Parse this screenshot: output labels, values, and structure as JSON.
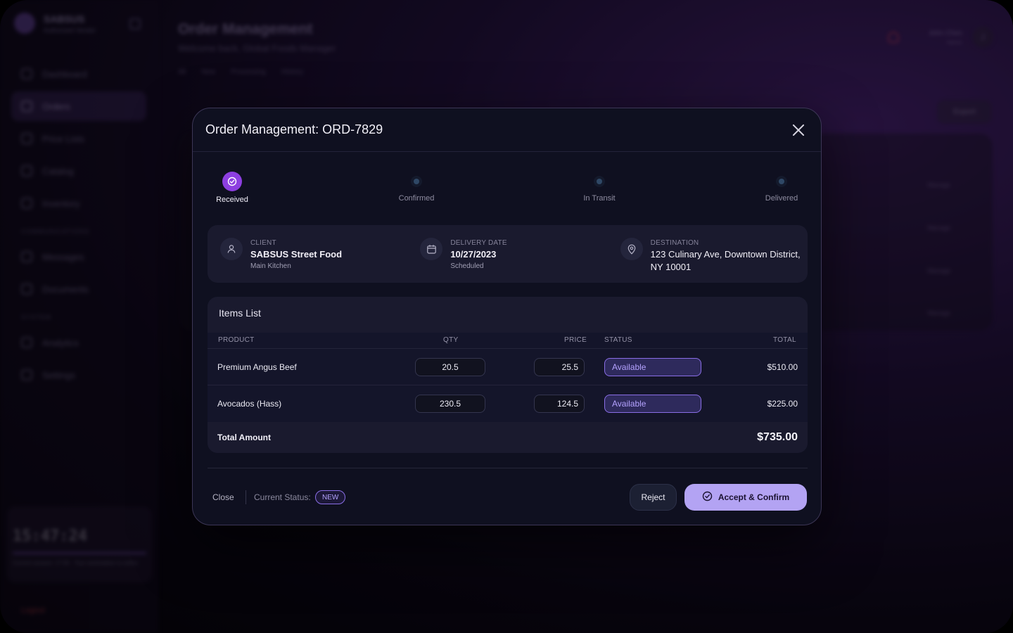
{
  "app": {
    "brand_name": "SABSUS",
    "brand_sub": "Authorized Vendor",
    "page_title": "Order Management",
    "page_subtitle": "Welcome back, Global Foods Manager",
    "filters": [
      "All",
      "New",
      "Processing",
      "History"
    ],
    "nav": [
      {
        "label": "Dashboard",
        "active": false
      },
      {
        "label": "Orders",
        "active": true
      },
      {
        "label": "Price Lists",
        "active": false
      },
      {
        "label": "Catalog",
        "active": false
      },
      {
        "label": "Inventory",
        "active": false
      }
    ],
    "nav_section_1": "Communications",
    "nav_comm": [
      {
        "label": "Messages"
      },
      {
        "label": "Documents"
      }
    ],
    "nav_section_2": "System",
    "nav_sys": [
      {
        "label": "Analytics"
      },
      {
        "label": "Settings"
      }
    ],
    "clock": {
      "time": "15:47:24",
      "note": "Current session: 17:56 · Your workstation is online"
    },
    "logout": "Logout",
    "user": {
      "name": "John Chen",
      "role": "Admin",
      "initial": "J"
    },
    "export_label": "Export",
    "row_link": "Manage"
  },
  "modal": {
    "title": "Order Management: ORD-7829",
    "steps": [
      {
        "label": "Received",
        "state": "done"
      },
      {
        "label": "Confirmed",
        "state": "pending"
      },
      {
        "label": "In Transit",
        "state": "pending"
      },
      {
        "label": "Delivered",
        "state": "pending"
      }
    ],
    "client": {
      "label": "CLIENT",
      "value": "SABSUS Street Food",
      "sub": "Main Kitchen",
      "icon": "user-icon"
    },
    "delivery": {
      "label": "DELIVERY DATE",
      "value": "10/27/2023",
      "sub": "Scheduled",
      "icon": "calendar-icon"
    },
    "destination": {
      "label": "DESTINATION",
      "value_line1": "123 Culinary Ave, Downtown District,",
      "value_line2": "NY 10001",
      "icon": "map-pin-icon"
    },
    "items_title": "Items List",
    "columns": {
      "product": "PRODUCT",
      "qty": "QTY",
      "price": "PRICE",
      "status": "STATUS",
      "total": "TOTAL"
    },
    "items": [
      {
        "product": "Premium Angus Beef",
        "qty": "20.5",
        "price": "25.5",
        "status": "Available",
        "total": "$510.00"
      },
      {
        "product": "Avocados (Hass)",
        "qty": "230.5",
        "price": "124.5",
        "status": "Available",
        "total": "$225.00"
      }
    ],
    "total_label": "Total Amount",
    "total_value": "$735.00",
    "footer": {
      "close_label": "Close",
      "status_label": "Current Status:",
      "status_badge": "NEW",
      "reject_label": "Reject",
      "accept_label": "Accept & Confirm"
    }
  },
  "colors": {
    "accent": "#8d3fe0",
    "accept_button": "#b3a3f3",
    "status_pill": "#b4a2ff",
    "modal_bg": "#0f1020"
  }
}
